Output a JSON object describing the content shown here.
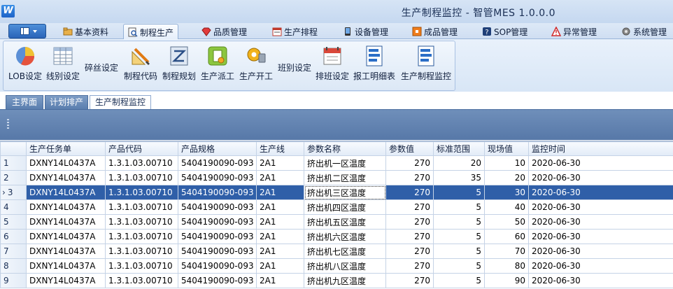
{
  "window": {
    "logo_text": "W",
    "title": "生产制程监控 - 智管MES 1.0.0.0"
  },
  "menu": {
    "tabs": [
      {
        "label": "基本资料",
        "icon": "folder-icon"
      },
      {
        "label": "制程生产",
        "icon": "document-search-icon",
        "active": true
      },
      {
        "label": "品质管理",
        "icon": "gem-icon"
      },
      {
        "label": "生产排程",
        "icon": "schedule-icon"
      },
      {
        "label": "设备管理",
        "icon": "phone-device-icon"
      },
      {
        "label": "成品管理",
        "icon": "box-icon"
      },
      {
        "label": "SOP管理",
        "icon": "help-book-icon"
      },
      {
        "label": "异常管理",
        "icon": "warning-icon"
      },
      {
        "label": "系统管理",
        "icon": "gear-icon"
      }
    ]
  },
  "ribbon": {
    "buttons": [
      {
        "label": "LOB设定",
        "icon": "pie-chart-icon"
      },
      {
        "label": "线别设定",
        "icon": "grid-table-icon"
      },
      {
        "label": "碎丝设定",
        "icon": "none"
      },
      {
        "label": "制程代码",
        "icon": "pencil-ruler-icon"
      },
      {
        "label": "制程规划",
        "icon": "plan-icon"
      },
      {
        "label": "生产派工",
        "icon": "dispatch-icon"
      },
      {
        "label": "生产开工",
        "icon": "key-lock-icon"
      },
      {
        "label": "班别设定",
        "icon": "none"
      },
      {
        "label": "排班设定",
        "icon": "calendar-icon"
      },
      {
        "label": "报工明细表",
        "icon": "report-list-icon"
      },
      {
        "label": "生产制程监控",
        "icon": "monitor-list-icon"
      }
    ]
  },
  "page_tabs": [
    {
      "label": "主界面"
    },
    {
      "label": "计划排产"
    },
    {
      "label": "生产制程监控",
      "active": true
    }
  ],
  "grid": {
    "columns": [
      "生产任务单",
      "产品代码",
      "产品规格",
      "生产线",
      "参数名称",
      "参数值",
      "标准范围",
      "现场值",
      "监控时间"
    ],
    "selected_row": 3,
    "rows": [
      {
        "no": "1",
        "task": "DXNY14L0437A",
        "code": "1.3.1.03.00710",
        "spec": "5404190090-093",
        "line": "2A1",
        "param": "挤出机一区温度",
        "value": "270",
        "std": "20",
        "field": "10",
        "time": "2020-06-30"
      },
      {
        "no": "2",
        "task": "DXNY14L0437A",
        "code": "1.3.1.03.00710",
        "spec": "5404190090-093",
        "line": "2A1",
        "param": "挤出机二区温度",
        "value": "270",
        "std": "35",
        "field": "20",
        "time": "2020-06-30"
      },
      {
        "no": "3",
        "task": "DXNY14L0437A",
        "code": "1.3.1.03.00710",
        "spec": "5404190090-093",
        "line": "2A1",
        "param": "挤出机三区温度",
        "value": "270",
        "std": "5",
        "field": "30",
        "time": "2020-06-30"
      },
      {
        "no": "4",
        "task": "DXNY14L0437A",
        "code": "1.3.1.03.00710",
        "spec": "5404190090-093",
        "line": "2A1",
        "param": "挤出机四区温度",
        "value": "270",
        "std": "5",
        "field": "40",
        "time": "2020-06-30"
      },
      {
        "no": "5",
        "task": "DXNY14L0437A",
        "code": "1.3.1.03.00710",
        "spec": "5404190090-093",
        "line": "2A1",
        "param": "挤出机五区温度",
        "value": "270",
        "std": "5",
        "field": "50",
        "time": "2020-06-30"
      },
      {
        "no": "6",
        "task": "DXNY14L0437A",
        "code": "1.3.1.03.00710",
        "spec": "5404190090-093",
        "line": "2A1",
        "param": "挤出机六区温度",
        "value": "270",
        "std": "5",
        "field": "60",
        "time": "2020-06-30"
      },
      {
        "no": "7",
        "task": "DXNY14L0437A",
        "code": "1.3.1.03.00710",
        "spec": "5404190090-093",
        "line": "2A1",
        "param": "挤出机七区温度",
        "value": "270",
        "std": "5",
        "field": "70",
        "time": "2020-06-30"
      },
      {
        "no": "8",
        "task": "DXNY14L0437A",
        "code": "1.3.1.03.00710",
        "spec": "5404190090-093",
        "line": "2A1",
        "param": "挤出机八区温度",
        "value": "270",
        "std": "5",
        "field": "80",
        "time": "2020-06-30"
      },
      {
        "no": "9",
        "task": "DXNY14L0437A",
        "code": "1.3.1.03.00710",
        "spec": "5404190090-093",
        "line": "2A1",
        "param": "挤出机九区温度",
        "value": "270",
        "std": "5",
        "field": "90",
        "time": "2020-06-30"
      }
    ]
  },
  "colors": {
    "selection": "#2f5fa8",
    "toolstrip": "#6a8ab6",
    "menu_bg": "#d6e4f5"
  }
}
